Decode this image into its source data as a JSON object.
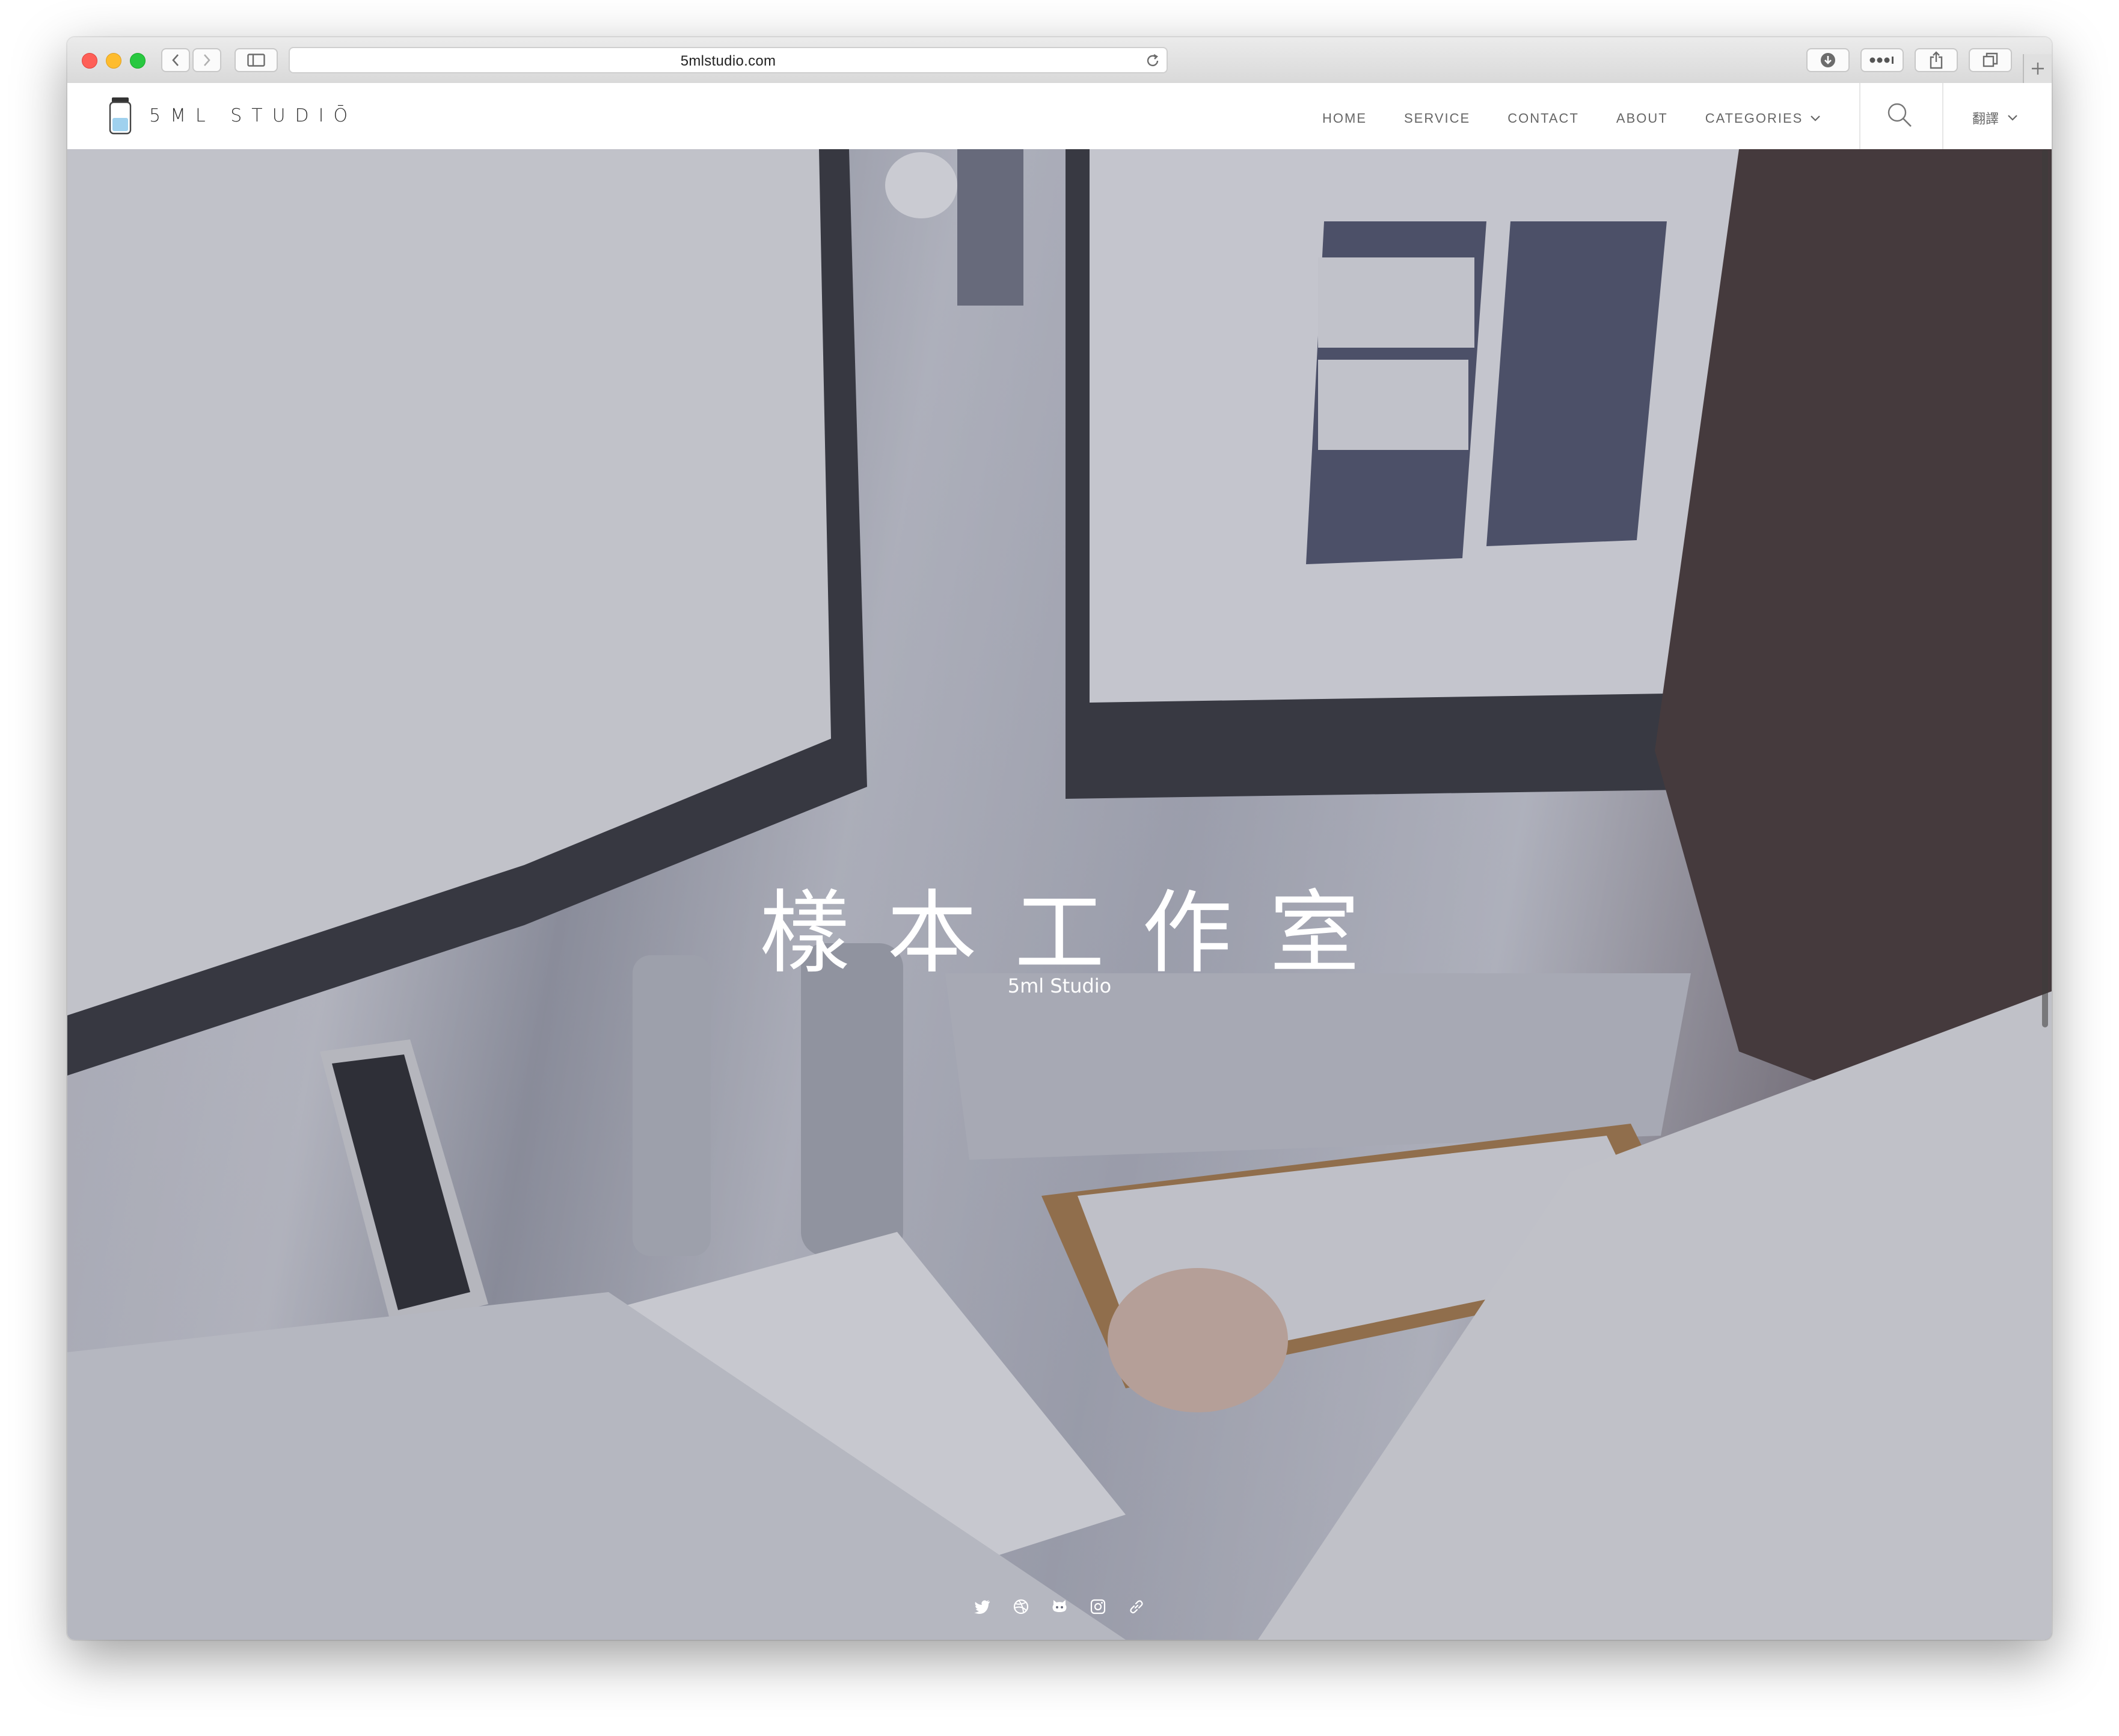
{
  "browser": {
    "url": "5mlstudio.com"
  },
  "site": {
    "logo_text": "5ML STUDIŌ",
    "nav": {
      "home": "HOME",
      "service": "SERVICE",
      "contact": "CONTACT",
      "about": "ABOUT",
      "categories": "CATEGORIES"
    },
    "language_label": "翻譯"
  },
  "hero": {
    "title": "樣本工作室",
    "subtitle": "5ml Studio",
    "social_icons": [
      "twitter-icon",
      "dribbble-icon",
      "github-icon",
      "instagram-icon",
      "link-icon"
    ]
  },
  "colors": {
    "white": "#ffffff",
    "nav_text": "#666666"
  }
}
